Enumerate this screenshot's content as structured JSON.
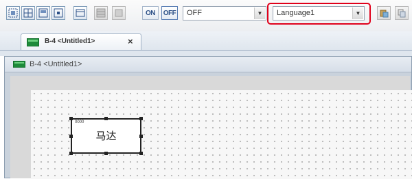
{
  "toolbar": {
    "state_on_label": "ON",
    "state_off_label": "OFF",
    "state_combo_value": "OFF",
    "language_combo_value": "Language1"
  },
  "tab": {
    "label": "B-4 <Untitled1>"
  },
  "document": {
    "title": "B-4 <Untitled1>"
  },
  "element": {
    "label": "马达",
    "tag": "0000"
  },
  "colors": {
    "highlight": "#e0001b",
    "accent": "#2b4f86"
  }
}
